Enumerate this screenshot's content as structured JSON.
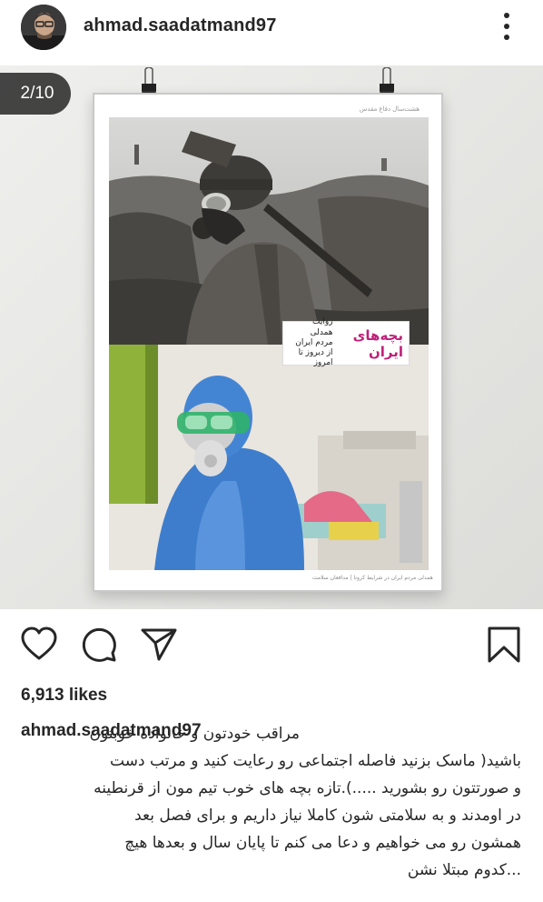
{
  "header": {
    "username": "ahmad.saadatmand97",
    "avatar_icon": "profile-photo",
    "more_icon": "vertical-ellipsis-icon"
  },
  "media": {
    "counter": "2/10",
    "poster": {
      "top_note": "هشت‌سال دفاع مقدس",
      "logo_mark": "بچه‌های ایران",
      "logo_text_line1": "روایت همدلی",
      "logo_text_line2": "مردم ایران",
      "logo_text_line3": "از دیروز تا امروز",
      "footer": "همدلی مردم ایران در شرایط کرونا | مدافعان سلامت"
    }
  },
  "actions": {
    "like_icon": "heart-icon",
    "comment_icon": "comment-icon",
    "share_icon": "send-icon",
    "save_icon": "bookmark-icon"
  },
  "likes": "6,913 likes",
  "caption": {
    "username": "ahmad.saadatmand97",
    "line1": "مراقب خودتون و خانواده خوبتون",
    "line2": "باشید( ماسک بزنید فاصله اجتماعی رو رعایت کنید و مرتب دست",
    "line3": "و صورتتون رو بشورید .....).تازه بچه های خوب تیم مون از قرنطینه",
    "line4": "در اومدند و به سلامتی شون کاملا نیاز داریم و برای فصل بعد",
    "line5": "همشون رو می خواهیم و دعا می کنم تا پایان سال و بعدها هیچ",
    "line6": "...کدوم مبتلا نشن"
  },
  "colors": {
    "text": "#262626",
    "counter_bg": "#262626",
    "media_bg": "#e9e9e7"
  }
}
